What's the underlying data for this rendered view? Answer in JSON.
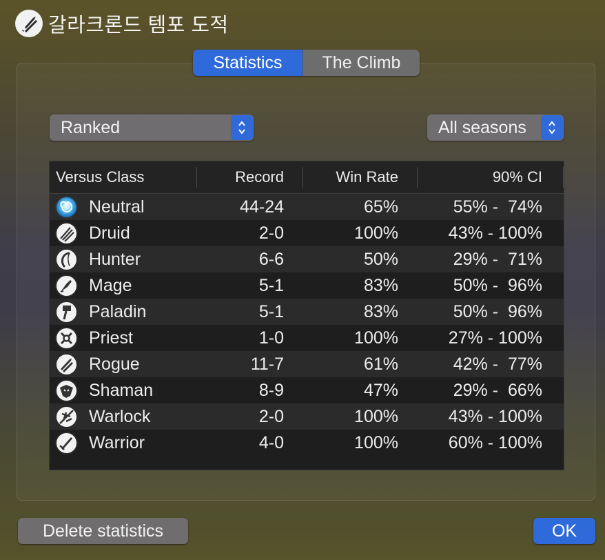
{
  "window": {
    "title": "갈라크론드 템포 도적",
    "icon": "rogue-class-icon"
  },
  "tabs": [
    {
      "label": "Statistics",
      "selected": true
    },
    {
      "label": "The Climb",
      "selected": false
    }
  ],
  "filters": {
    "mode": {
      "value": "Ranked"
    },
    "season": {
      "value": "All seasons"
    }
  },
  "table": {
    "columns": [
      "Versus Class",
      "Record",
      "Win Rate",
      "90% CI"
    ],
    "rows": [
      {
        "icon": "neutral-icon",
        "class": "Neutral",
        "record": "44-24",
        "win_rate": "65%",
        "ci": "55% -  74%"
      },
      {
        "icon": "druid-icon",
        "class": "Druid",
        "record": "2-0",
        "win_rate": "100%",
        "ci": "43% - 100%"
      },
      {
        "icon": "hunter-icon",
        "class": "Hunter",
        "record": "6-6",
        "win_rate": "50%",
        "ci": "29% -  71%"
      },
      {
        "icon": "mage-icon",
        "class": "Mage",
        "record": "5-1",
        "win_rate": "83%",
        "ci": "50% -  96%"
      },
      {
        "icon": "paladin-icon",
        "class": "Paladin",
        "record": "5-1",
        "win_rate": "83%",
        "ci": "50% -  96%"
      },
      {
        "icon": "priest-icon",
        "class": "Priest",
        "record": "1-0",
        "win_rate": "100%",
        "ci": "27% - 100%"
      },
      {
        "icon": "rogue-icon",
        "class": "Rogue",
        "record": "11-7",
        "win_rate": "61%",
        "ci": "42% -  77%"
      },
      {
        "icon": "shaman-icon",
        "class": "Shaman",
        "record": "8-9",
        "win_rate": "47%",
        "ci": "29% -  66%"
      },
      {
        "icon": "warlock-icon",
        "class": "Warlock",
        "record": "2-0",
        "win_rate": "100%",
        "ci": "43% - 100%"
      },
      {
        "icon": "warrior-icon",
        "class": "Warrior",
        "record": "4-0",
        "win_rate": "100%",
        "ci": "60% - 100%"
      }
    ]
  },
  "buttons": {
    "delete": "Delete statistics",
    "ok": "OK"
  },
  "colors": {
    "accent": "#2e6ad9",
    "control_gray": "#6f6d6e",
    "table_bg": "#1e1e1f"
  }
}
